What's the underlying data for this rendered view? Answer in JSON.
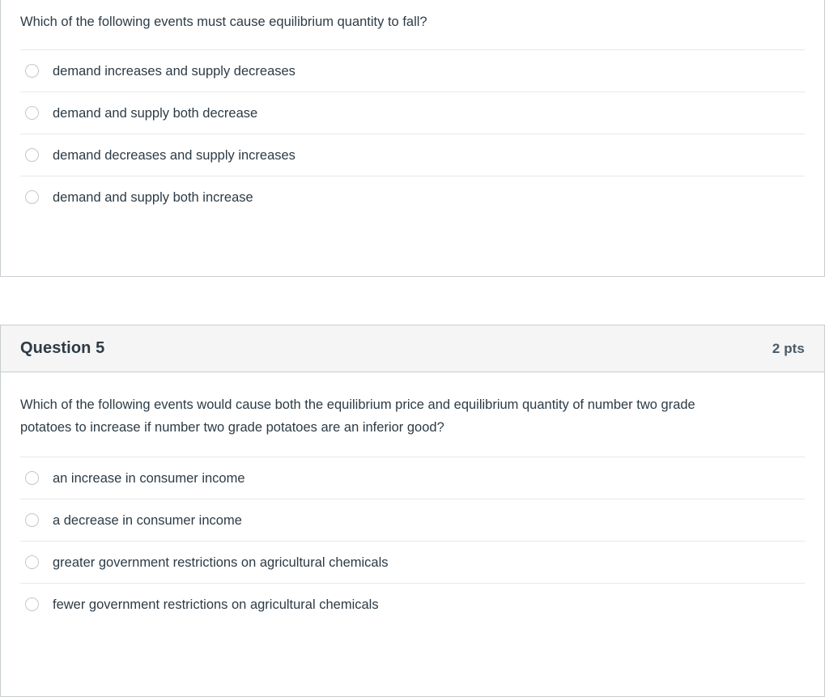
{
  "quiz": {
    "questions": [
      {
        "header_visible": false,
        "title": "",
        "points": "",
        "prompt": "Which of the following events must cause equilibrium quantity to fall?",
        "options": [
          "demand increases and supply decreases",
          "demand and supply both decrease",
          "demand decreases and supply increases",
          "demand and supply both increase"
        ]
      },
      {
        "header_visible": true,
        "title": "Question 5",
        "points": "2 pts",
        "prompt": "Which of the following events would cause both the equilibrium price and equilibrium quantity of number two grade potatoes to increase if number two grade potatoes are an inferior good?",
        "options": [
          "an increase in consumer income",
          "a decrease in consumer income",
          "greater government restrictions on agricultural chemicals",
          "fewer government restrictions on agricultural chemicals"
        ]
      }
    ]
  },
  "colors": {
    "card_border": "#c7cdd1",
    "header_background": "#f5f5f5",
    "title_text": "#2d3b45",
    "points_text": "#4a5b68",
    "separator": "#e8e8e8",
    "radio_border": "#c4c8cb"
  }
}
